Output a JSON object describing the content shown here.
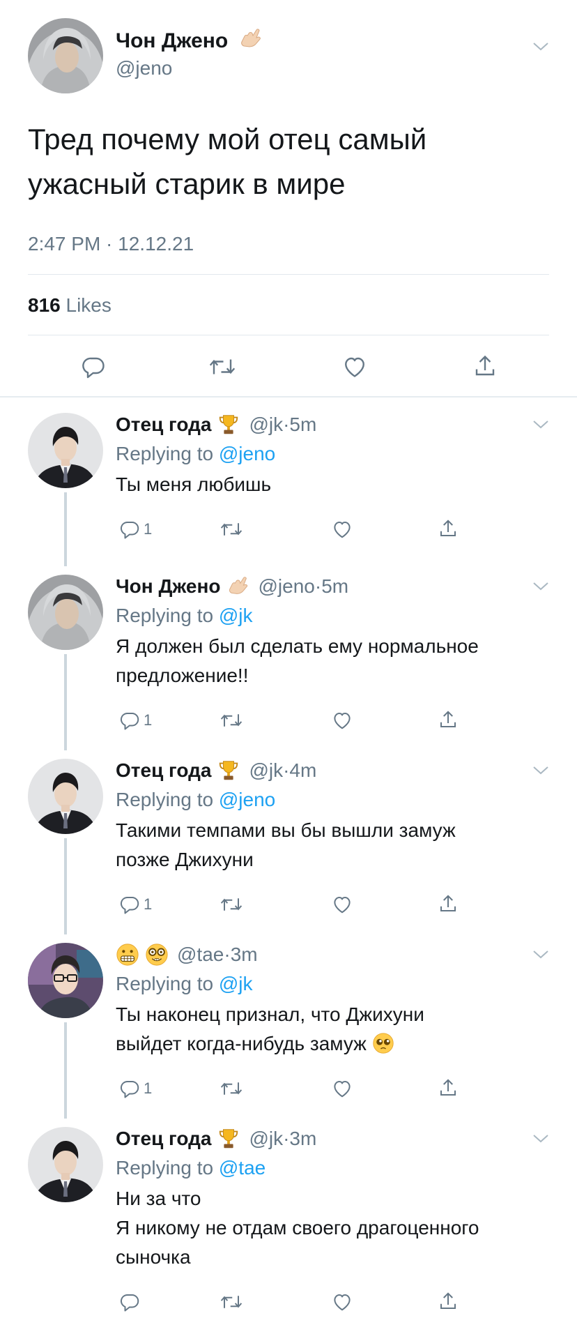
{
  "main_tweet": {
    "author_name": "Чон Джено",
    "author_emoji": "call-me-hand-icon",
    "handle": "@jeno",
    "text": "Тред почему мой отец самый ужасный старик в мире",
    "timestamp": "2:47 PM · 12.12.21",
    "likes_count": "816",
    "likes_label": "Likes"
  },
  "replies": [
    {
      "name": "Отец года",
      "name_emoji": "trophy-icon",
      "handle": "@jk",
      "time": "5m",
      "replying_prefix": "Replying to",
      "replying_to": "@jeno",
      "lines": [
        "Ты меня любишь"
      ],
      "reply_count": "1"
    },
    {
      "name": "Чон Джено",
      "name_emoji": "call-me-hand-icon",
      "handle": "@jeno",
      "time": "5m",
      "replying_prefix": "Replying to",
      "replying_to": "@jk",
      "lines": [
        "Я должен был сделать ему нормальное",
        "предложение!!"
      ],
      "reply_count": "1"
    },
    {
      "name": "Отец года",
      "name_emoji": "trophy-icon",
      "handle": "@jk",
      "time": "4m",
      "replying_prefix": "Replying to",
      "replying_to": "@jeno",
      "lines": [
        "Такими темпами вы бы вышли замуж",
        "позже Джихуни"
      ],
      "reply_count": "1"
    },
    {
      "name": "",
      "name_emoji": "grimacing-face-icon nerd-face-icon",
      "handle": "@tae",
      "time": "3m",
      "replying_prefix": "Replying to",
      "replying_to": "@jk",
      "lines": [
        "Ты наконец признал, что Джихуни",
        "выйдет когда-нибудь замуж"
      ],
      "trailing_emoji": "pleading-face-icon",
      "reply_count": "1"
    },
    {
      "name": "Отец года",
      "name_emoji": "trophy-icon",
      "handle": "@jk",
      "time": "3m",
      "replying_prefix": "Replying to",
      "replying_to": "@tae",
      "lines": [
        "Ни за что",
        "Я никому не отдам своего драгоценного",
        "сыночка"
      ],
      "reply_count": ""
    }
  ],
  "colors": {
    "text": "#14171a",
    "secondary": "#657786",
    "mention": "#1da1f2",
    "divider": "#e1e8ed",
    "thread_line": "#ccd6dd"
  }
}
